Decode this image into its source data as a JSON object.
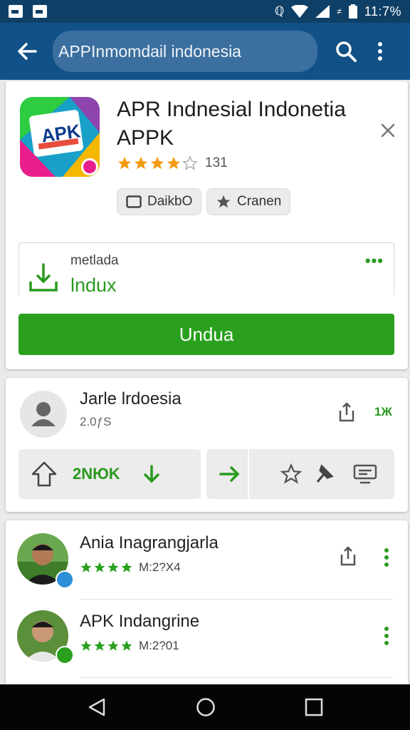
{
  "status_bar": {
    "time": "11:7%"
  },
  "app_bar": {
    "search_text": "APPInmomdail indonesia"
  },
  "app": {
    "title": "APR Indnesial Indonetia APPK",
    "icon_text": "APK",
    "rating": 4,
    "rating_count": "131",
    "chips": [
      {
        "label": "DaikbO",
        "icon": "square-icon"
      },
      {
        "label": "Cranen",
        "icon": "star-icon"
      }
    ],
    "download_panel": {
      "label": "metlada",
      "value": "lndux",
      "more": "•••"
    },
    "install_label": "Undua"
  },
  "publisher": {
    "name": "Jarle lrdoesia",
    "subtitle": "2.0ƒS",
    "count": "1Ж",
    "action_label": "2NЮK"
  },
  "reviews": [
    {
      "name": "Ania Inagrangjarla",
      "rating": 4,
      "meta": "M:2?X4",
      "badge_color": "#2f8fd8"
    },
    {
      "name": "APK Indangrine",
      "rating": 4,
      "meta": "M:2?01",
      "badge_color": "#2ba01f"
    }
  ],
  "colors": {
    "status_bar": "#0e3f66",
    "app_bar": "#115187",
    "accent_green": "#2ba01f",
    "star_orange": "#f39c12"
  }
}
